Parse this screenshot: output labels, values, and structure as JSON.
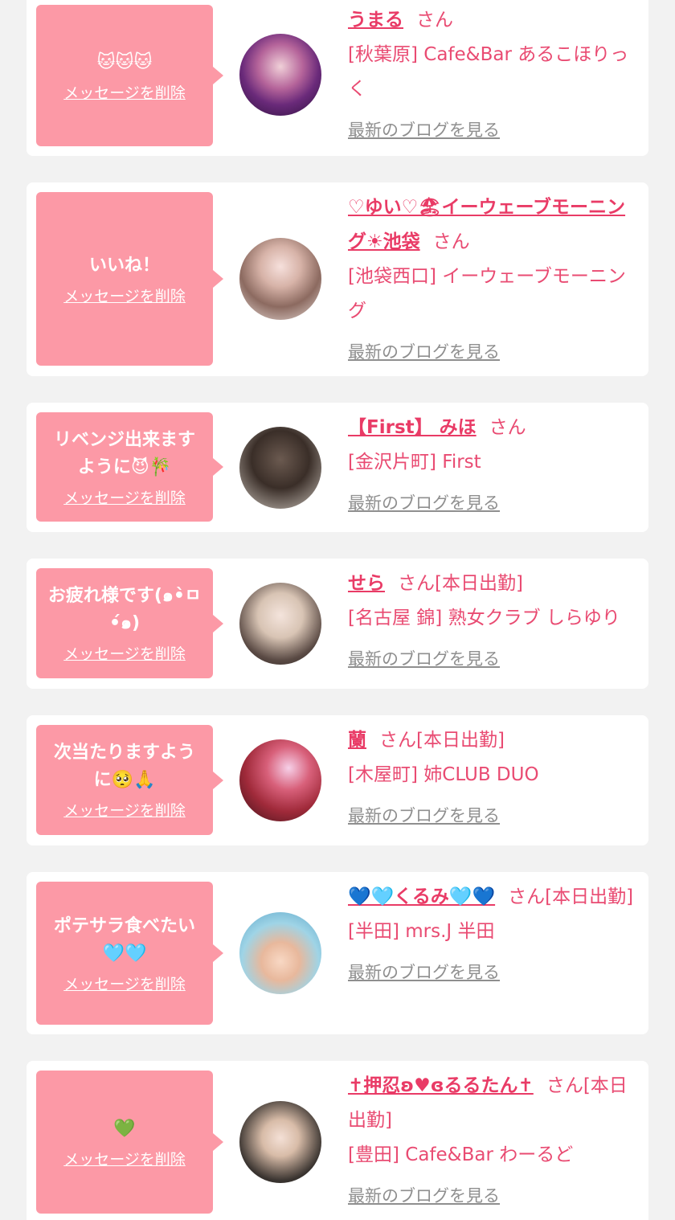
{
  "theme": {
    "bubble_color": "#fc99a6",
    "name_color": "#e93b66",
    "shop_color": "#e94b72",
    "blog_link_color": "#8f8f8f",
    "background": "#f2f2f2"
  },
  "entries": [
    {
      "message": "🐱🐱🐱",
      "delete_label": "メッセージを削除",
      "name": "うまる",
      "suffix": "さん",
      "shop": "[秋葉原] Cafe&Bar あるこほりっく",
      "blog_label": "最新のブログを見る"
    },
    {
      "message": "いいね！",
      "delete_label": "メッセージを削除",
      "name": "♡ゆい♡🏖イーウェーブモーニング☀池袋",
      "suffix": "さん",
      "shop": "[池袋西口] イーウェーブモーニング",
      "blog_label": "最新のブログを見る"
    },
    {
      "message": "リベンジ出来ますように😈🎋",
      "delete_label": "メッセージを削除",
      "name": "【First】 みほ",
      "suffix": "さん",
      "shop": "[金沢片町] First",
      "blog_label": "最新のブログを見る"
    },
    {
      "message": "お疲れ様です(๑•̀ㅁ•́๑)",
      "delete_label": "メッセージを削除",
      "name": "せら",
      "suffix": "さん[本日出勤]",
      "shop": "[名古屋 錦] 熟女クラブ しらゆり",
      "blog_label": "最新のブログを見る"
    },
    {
      "message": "次当たりますように🥺🙏",
      "delete_label": "メッセージを削除",
      "name": "蘭",
      "suffix": "さん[本日出勤]",
      "shop": "[木屋町] 姉CLUB DUO",
      "blog_label": "最新のブログを見る"
    },
    {
      "message": "ポテサラ食べたい🩵🩵",
      "delete_label": "メッセージを削除",
      "name": "💙🩵くるみ🩵💙",
      "suffix": "さん[本日出勤]",
      "shop": "[半田] mrs.J 半田",
      "blog_label": "最新のブログを見る"
    },
    {
      "message": "💚",
      "delete_label": "メッセージを削除",
      "name": "✝押忍ʚ♥ɞるるたん✝",
      "suffix": "さん[本日出勤]",
      "shop": "[豊田] Cafe&Bar わーるど",
      "blog_label": "最新のブログを見る"
    }
  ]
}
